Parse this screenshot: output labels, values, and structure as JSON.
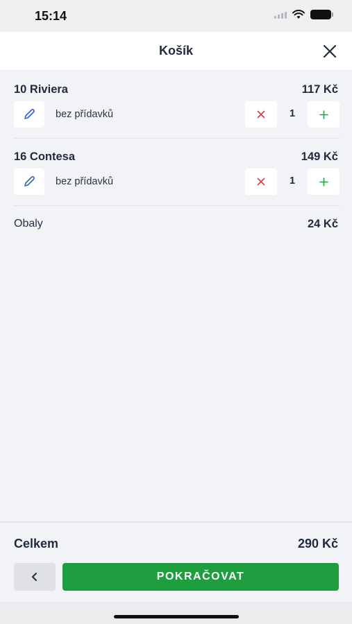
{
  "status_bar": {
    "time": "15:14"
  },
  "header": {
    "title": "Košík"
  },
  "cart": {
    "items": [
      {
        "name": "10 Riviera",
        "price": "117 Kč",
        "description": "bez přídavků",
        "quantity": "1"
      },
      {
        "name": "16 Contesa",
        "price": "149 Kč",
        "description": "bez přídavků",
        "quantity": "1"
      }
    ],
    "packaging": {
      "label": "Obaly",
      "price": "24 Kč"
    }
  },
  "footer": {
    "total_label": "Celkem",
    "total_price": "290 Kč",
    "back_label": "<",
    "continue_label": "POKRAČOVAT"
  },
  "icons": {
    "edit": "pencil-icon",
    "remove": "x-icon",
    "add": "plus-icon",
    "close": "close-icon"
  },
  "colors": {
    "accent": "#1f9e3f",
    "remove": "#d83a4a",
    "edit": "#2f64c8",
    "text": "#1f2a3d"
  }
}
